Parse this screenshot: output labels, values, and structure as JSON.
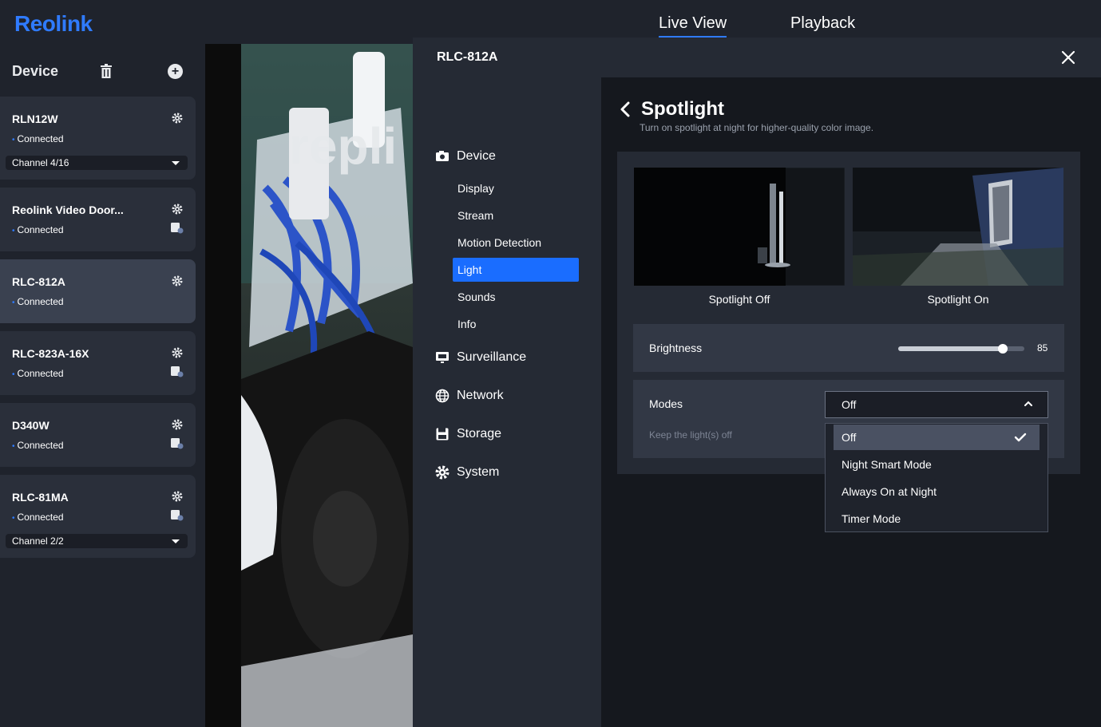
{
  "app": {
    "logo": "Reolink"
  },
  "topnav": {
    "live_view": "Live View",
    "playback": "Playback"
  },
  "sidebar": {
    "title": "Device",
    "devices": [
      {
        "name": "RLN12W",
        "status": "Connected",
        "channel": "Channel 4/16"
      },
      {
        "name": "Reolink Video Door...",
        "status": "Connected"
      },
      {
        "name": "RLC-812A",
        "status": "Connected"
      },
      {
        "name": "RLC-823A-16X",
        "status": "Connected"
      },
      {
        "name": "D340W",
        "status": "Connected"
      },
      {
        "name": "RLC-81MA",
        "status": "Connected",
        "channel": "Channel 2/2"
      }
    ]
  },
  "modal": {
    "title": "RLC-812A",
    "menu": {
      "device": "Device",
      "display": "Display",
      "stream": "Stream",
      "motion_detection": "Motion Detection",
      "light": "Light",
      "sounds": "Sounds",
      "info": "Info",
      "surveillance": "Surveillance",
      "network": "Network",
      "storage": "Storage",
      "system": "System"
    },
    "content": {
      "title": "Spotlight",
      "subtitle": "Turn on spotlight at night for higher-quality color image.",
      "preview_off": "Spotlight Off",
      "preview_on": "Spotlight On",
      "brightness_label": "Brightness",
      "brightness_value": "85",
      "brightness_fraction": 0.83,
      "modes_label": "Modes",
      "modes_selected": "Off",
      "modes_desc": "Keep the light(s) off",
      "mode_options": [
        "Off",
        "Night Smart Mode",
        "Always On at Night",
        "Timer Mode"
      ]
    }
  },
  "colors": {
    "accent": "#1a6dff",
    "logo": "#2f7bff"
  }
}
